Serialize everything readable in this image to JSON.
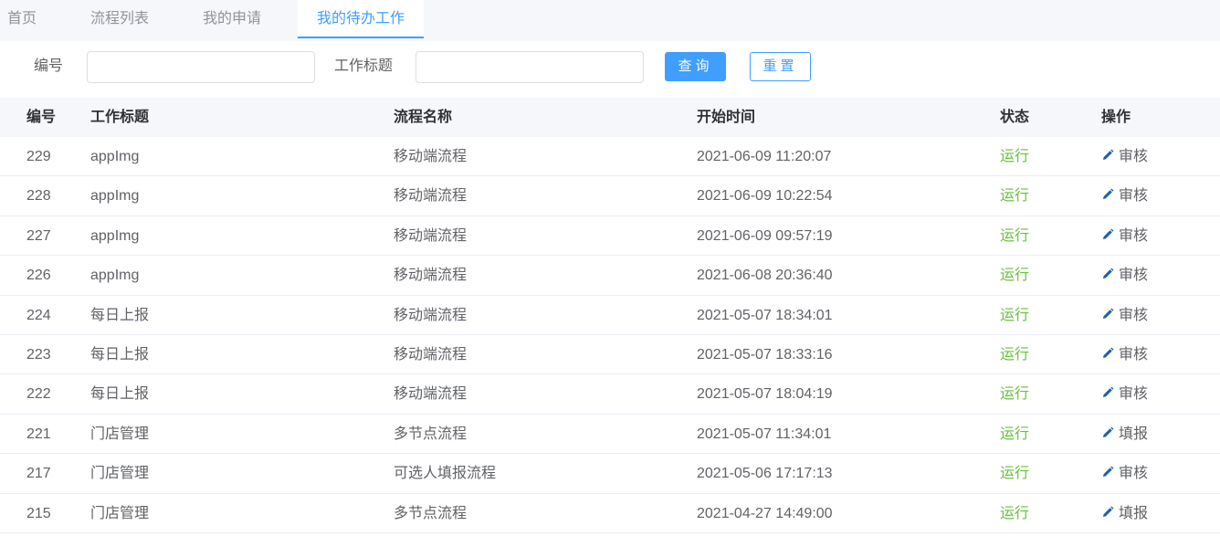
{
  "tabs": [
    {
      "label": "首页"
    },
    {
      "label": "流程列表"
    },
    {
      "label": "我的申请"
    },
    {
      "label": "我的待办工作",
      "active": true
    }
  ],
  "search": {
    "number_label": "编号",
    "number_value": "",
    "title_label": "工作标题",
    "title_value": "",
    "query_button": "查询",
    "reset_button": "重置"
  },
  "table": {
    "columns": [
      "编号",
      "工作标题",
      "流程名称",
      "开始时间",
      "状态",
      "操作"
    ],
    "rows": [
      {
        "id": "229",
        "title": "appImg",
        "flow": "移动端流程",
        "start": "2021-06-09 11:20:07",
        "status": "运行",
        "action": "审核"
      },
      {
        "id": "228",
        "title": "appImg",
        "flow": "移动端流程",
        "start": "2021-06-09 10:22:54",
        "status": "运行",
        "action": "审核"
      },
      {
        "id": "227",
        "title": "appImg",
        "flow": "移动端流程",
        "start": "2021-06-09 09:57:19",
        "status": "运行",
        "action": "审核"
      },
      {
        "id": "226",
        "title": "appImg",
        "flow": "移动端流程",
        "start": "2021-06-08 20:36:40",
        "status": "运行",
        "action": "审核"
      },
      {
        "id": "224",
        "title": "每日上报",
        "flow": "移动端流程",
        "start": "2021-05-07 18:34:01",
        "status": "运行",
        "action": "审核"
      },
      {
        "id": "223",
        "title": "每日上报",
        "flow": "移动端流程",
        "start": "2021-05-07 18:33:16",
        "status": "运行",
        "action": "审核"
      },
      {
        "id": "222",
        "title": "每日上报",
        "flow": "移动端流程",
        "start": "2021-05-07 18:04:19",
        "status": "运行",
        "action": "审核"
      },
      {
        "id": "221",
        "title": "门店管理",
        "flow": "多节点流程",
        "start": "2021-05-07 11:34:01",
        "status": "运行",
        "action": "填报"
      },
      {
        "id": "217",
        "title": "门店管理",
        "flow": "可选人填报流程",
        "start": "2021-05-06 17:17:13",
        "status": "运行",
        "action": "审核"
      },
      {
        "id": "215",
        "title": "门店管理",
        "flow": "多节点流程",
        "start": "2021-04-27 14:49:00",
        "status": "运行",
        "action": "填报"
      }
    ]
  },
  "colors": {
    "primary": "#409eff",
    "success": "#67c23a",
    "action_icon": "#1f5fa8"
  },
  "icons": {
    "action": "pencil-icon"
  }
}
